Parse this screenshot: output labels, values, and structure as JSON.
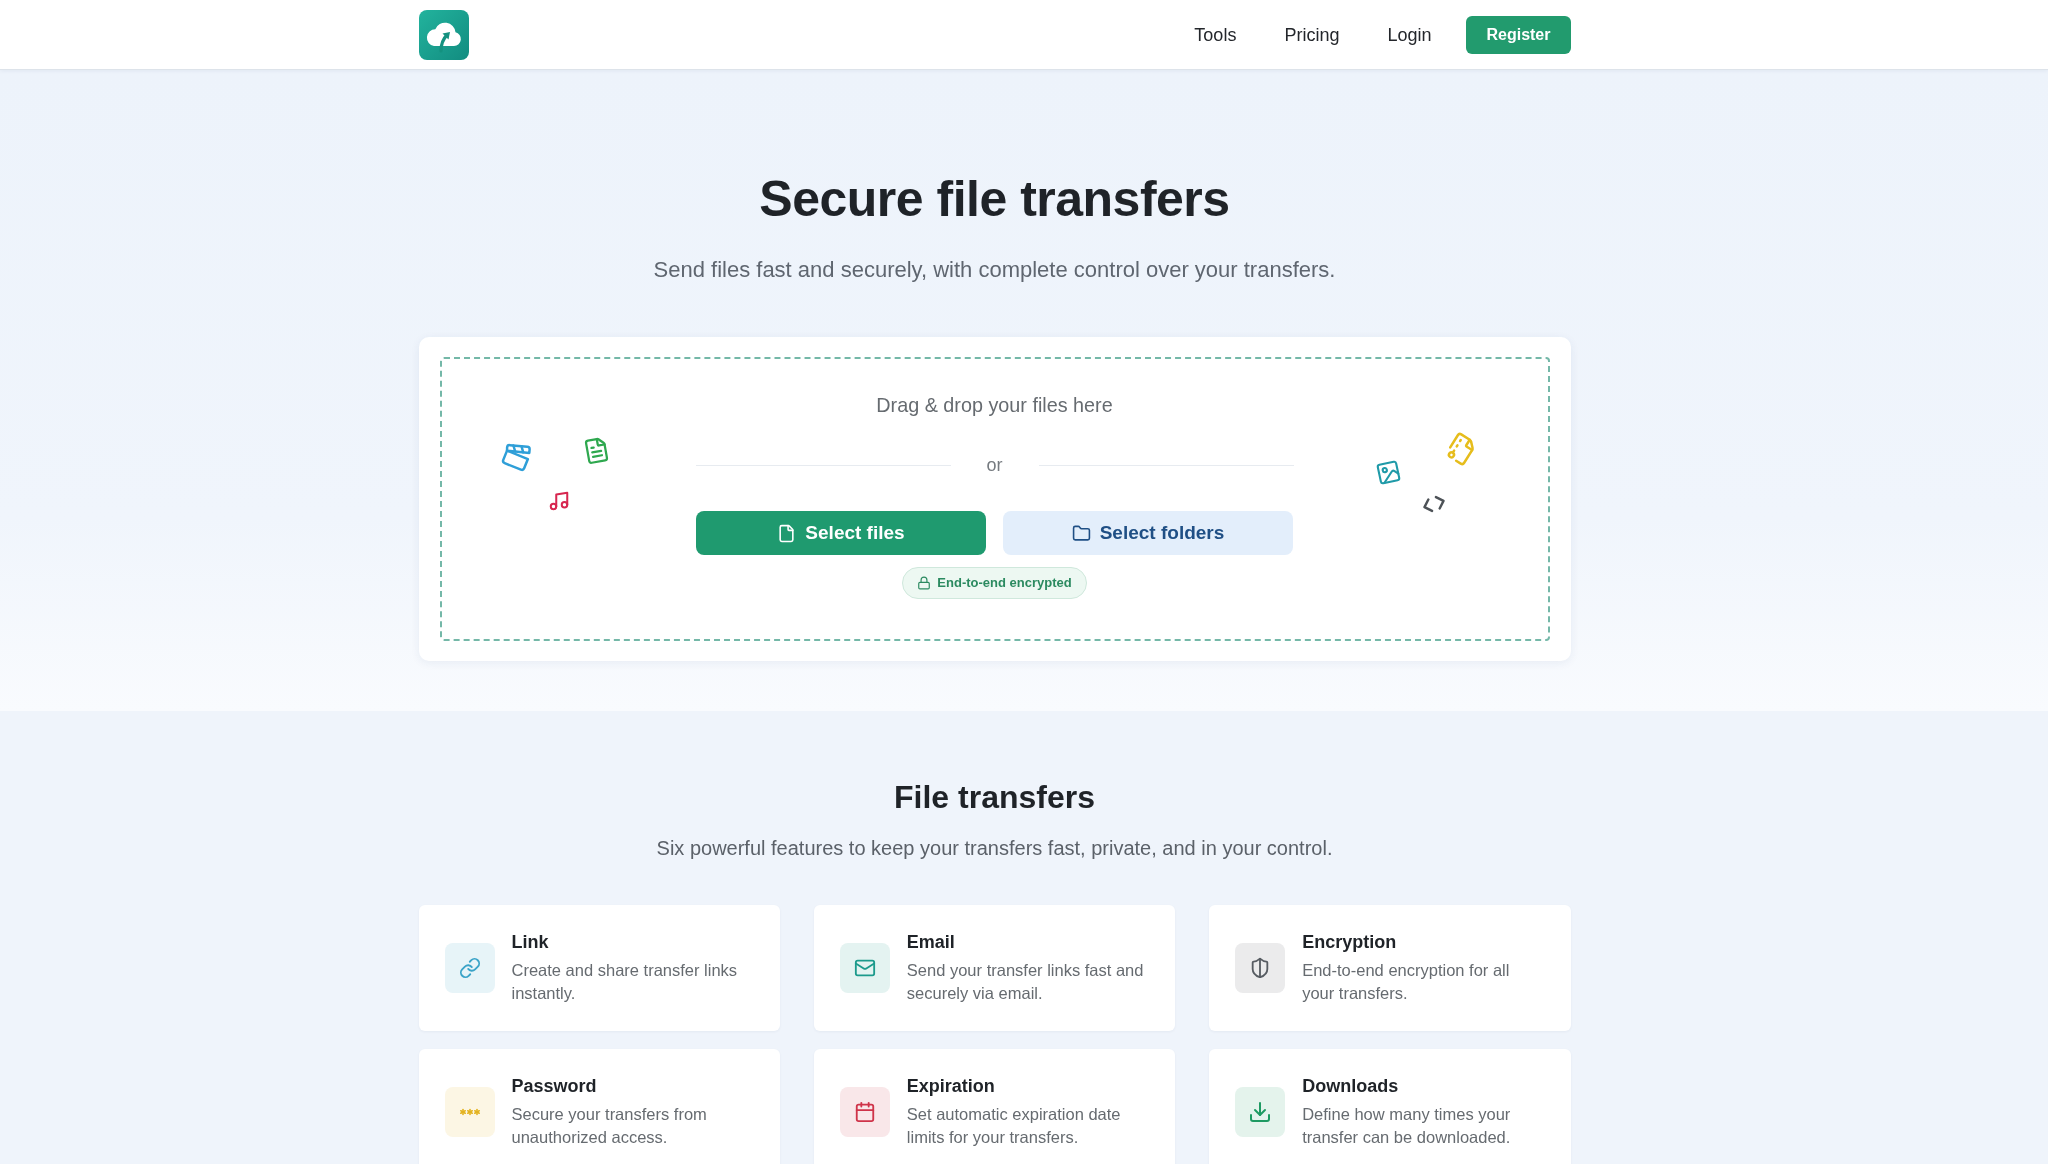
{
  "header": {
    "nav": [
      {
        "label": "Tools"
      },
      {
        "label": "Pricing"
      },
      {
        "label": "Login"
      }
    ],
    "register_button": "Register"
  },
  "hero": {
    "title": "Secure file transfers",
    "subtitle": "Send files fast and securely, with complete control over your transfers."
  },
  "upload": {
    "prompt": "Drag & drop your files here",
    "separator": "or",
    "buttons": [
      {
        "label": "Select files",
        "kind": "primary"
      },
      {
        "label": "Select folders",
        "kind": "secondary"
      }
    ],
    "badge": "End-to-end encrypted"
  },
  "features": {
    "title": "File transfers",
    "subtitle": "Six powerful features to keep your transfers fast, private, and in your control.",
    "items": [
      {
        "title": "Link",
        "description": "Create and share transfer links instantly.",
        "color": "#3aa3c8"
      },
      {
        "title": "Email",
        "description": "Send your transfer links fast and securely via email.",
        "color": "#1c9a8c"
      },
      {
        "title": "Encryption",
        "description": "End-to-end encryption for all your transfers.",
        "color": "#575c62"
      },
      {
        "title": "Password",
        "description": "Secure your transfers from unauthorized access.",
        "color": "#e3b321"
      },
      {
        "title": "Expiration",
        "description": "Set automatic expiration date limits for your transfers.",
        "color": "#cf3349"
      },
      {
        "title": "Downloads",
        "description": "Define how many times your transfer can be downloaded.",
        "color": "#1e9a62"
      }
    ]
  }
}
